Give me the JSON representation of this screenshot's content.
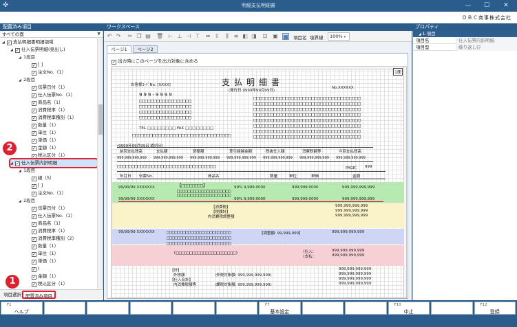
{
  "window": {
    "title": "明細支払明細書",
    "controls": [
      "—",
      "☐",
      "✕"
    ]
  },
  "company": "ＯＢＣ商事株式会社",
  "left_panel": {
    "header": "配置済み項目",
    "filter": "すべての面",
    "tree": [
      {
        "depth": 0,
        "toggle": "◢",
        "checked": true,
        "label": "支払明細書明細領域"
      },
      {
        "depth": 1,
        "toggle": "◢",
        "checked": true,
        "label": "仕入伝票明細(見出し)"
      },
      {
        "depth": 2,
        "toggle": "◢",
        "checked": false,
        "label": "1段目"
      },
      {
        "depth": 3,
        "toggle": "",
        "checked": true,
        "label": "[        ]"
      },
      {
        "depth": 3,
        "toggle": "",
        "checked": true,
        "label": "注文No.（1）"
      },
      {
        "depth": 2,
        "toggle": "◢",
        "checked": false,
        "label": "2段目"
      },
      {
        "depth": 3,
        "toggle": "",
        "checked": true,
        "label": "伝票日付（1）"
      },
      {
        "depth": 3,
        "toggle": "",
        "checked": true,
        "label": "仕入伝票No.（1）"
      },
      {
        "depth": 3,
        "toggle": "",
        "checked": true,
        "label": "商品名（1）"
      },
      {
        "depth": 3,
        "toggle": "",
        "checked": true,
        "label": "消費税率（1）"
      },
      {
        "depth": 3,
        "toggle": "",
        "checked": true,
        "label": "消費税率種別（1）"
      },
      {
        "depth": 3,
        "toggle": "",
        "checked": true,
        "label": "数量（1）"
      },
      {
        "depth": 3,
        "toggle": "",
        "checked": true,
        "label": "単位（1）"
      },
      {
        "depth": 3,
        "toggle": "",
        "checked": true,
        "label": "単価（1）"
      },
      {
        "depth": 3,
        "toggle": "",
        "checked": true,
        "label": "金額（1）"
      },
      {
        "depth": 3,
        "toggle": "",
        "checked": true,
        "label": "税込区分（1）"
      },
      {
        "depth": 1,
        "toggle": "◢",
        "checked": true,
        "label": "仕入伝票内訳明細",
        "selected": true
      },
      {
        "depth": 2,
        "toggle": "◢",
        "checked": false,
        "label": "1段目"
      },
      {
        "depth": 3,
        "toggle": "",
        "checked": true,
        "label": "線（5）"
      },
      {
        "depth": 3,
        "toggle": "",
        "checked": true,
        "label": "[        ]"
      },
      {
        "depth": 3,
        "toggle": "",
        "checked": true,
        "label": "注文No.（1）"
      },
      {
        "depth": 2,
        "toggle": "◢",
        "checked": false,
        "label": "2段目"
      },
      {
        "depth": 3,
        "toggle": "",
        "checked": true,
        "label": "伝票日付（1）"
      },
      {
        "depth": 3,
        "toggle": "",
        "checked": true,
        "label": "仕入伝票No.（1）"
      },
      {
        "depth": 3,
        "toggle": "",
        "checked": true,
        "label": "商品名（1）"
      },
      {
        "depth": 3,
        "toggle": "",
        "checked": true,
        "label": "消費税率（1）"
      },
      {
        "depth": 3,
        "toggle": "",
        "checked": true,
        "label": "消費税率種別（2）"
      },
      {
        "depth": 3,
        "toggle": "",
        "checked": true,
        "label": "数量（1）"
      },
      {
        "depth": 3,
        "toggle": "",
        "checked": true,
        "label": "単位（1）"
      },
      {
        "depth": 3,
        "toggle": "",
        "checked": true,
        "label": "単価（1）"
      },
      {
        "depth": 3,
        "toggle": "",
        "checked": true,
        "label": "("
      },
      {
        "depth": 3,
        "toggle": "",
        "checked": true,
        "label": "金額（1）"
      },
      {
        "depth": 3,
        "toggle": "",
        "checked": true,
        "label": "税込区分（1）"
      }
    ],
    "tabs": [
      "項目選択",
      "配置済み項目"
    ]
  },
  "workspace": {
    "header": "ワークスペース",
    "toolbar": {
      "item_name_label": "項目名",
      "border_label": "境界線",
      "zoom": "100%"
    },
    "page_tabs": [
      "ページ1",
      "ページ2"
    ],
    "print_option": "出力時にこのページを出力対象に含める",
    "page_badge": "1面",
    "doc": {
      "customer": "お客様ｺｰﾄﾞNo. [XXXX]",
      "title": "支払明細書",
      "issued": "(発行日 9999年99月99日)",
      "doc_no": "No.XXXXXX",
      "zip": "999-9999",
      "tel": "TEL □□□□□□□□  FAX □□□□□□□□",
      "period": "(9999年99月99日 締切分)",
      "summary_headers": [
        "前回支払残高",
        "支払額",
        "調整額",
        "差引繰越金額",
        "税抜仕入額",
        "消費税額等",
        "今回支払残高"
      ],
      "summary_value": "999,999,999,999",
      "page_label": "PAGE：",
      "page_value": "999",
      "detail_headers": [
        "年月日",
        "伝票No.",
        "商品名",
        "数量",
        "単位",
        "単価",
        "金額"
      ],
      "row_date": "99/99/99 XXXXXXX",
      "row_qty": "9,999.0000",
      "row_price": "999,999.0000",
      "row_amount": "999,999,999,999",
      "row_tax": "99%",
      "consumption_tax": "【消費税】",
      "tax_total": "【税額計】",
      "adjustment": "内消費税調整額",
      "adj_amount": "【調整額: 99,999,999】",
      "purchase": "〈仕入：",
      "payment": "〈支払：",
      "total": "【計】",
      "outside_tax": "外税額",
      "outside_target": "(外税対象額:    999,999,999,999)",
      "purchase_total": "【仕入合計】",
      "inclusive_tax": "内消費税額等",
      "inclusive_target": "(課税対象額:    999,999,999,999)"
    }
  },
  "properties": {
    "header": "プロパティ",
    "group": "1.項目",
    "rows": [
      {
        "key": "項目名",
        "value": "仕入伝票内訳明細"
      },
      {
        "key": "項目型",
        "value": "繰り返し行"
      }
    ]
  },
  "function_keys": [
    {
      "num": "F1",
      "label": "ヘルプ"
    },
    {
      "num": "",
      "label": ""
    },
    {
      "num": "",
      "label": ""
    },
    {
      "num": "",
      "label": ""
    },
    {
      "num": "",
      "label": ""
    },
    {
      "num": "",
      "label": ""
    },
    {
      "num": "F7",
      "label": "基本設定"
    },
    {
      "num": "",
      "label": ""
    },
    {
      "num": "",
      "label": ""
    },
    {
      "num": "F10",
      "label": "中止"
    },
    {
      "num": "",
      "label": ""
    },
    {
      "num": "F12",
      "label": "登録"
    }
  ],
  "markers": [
    "1",
    "2"
  ],
  "colors": {
    "brand": "#2b5d8c",
    "highlight": "#e02030",
    "green_band": "#b7eab1",
    "blue_band": "#cfd6f5",
    "pink_band": "#f7d0d6",
    "yellow_band": "#fbf3c8"
  }
}
